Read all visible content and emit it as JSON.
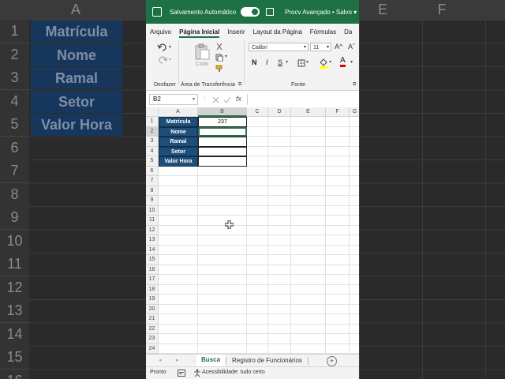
{
  "background": {
    "columns": [
      "A",
      "E",
      "F"
    ],
    "rows": [
      "1",
      "2",
      "3",
      "4",
      "5",
      "6",
      "7",
      "8",
      "9",
      "10",
      "11",
      "12",
      "13",
      "14",
      "15",
      "16"
    ],
    "labels": [
      "Matrícula",
      "Nome",
      "Ramal",
      "Setor",
      "Valor Hora"
    ]
  },
  "titlebar": {
    "autosave_label": "Salvamento Automático",
    "doc_name": "Procv Avançado • Salvo",
    "doc_caret": "▾"
  },
  "tabs": [
    "Arquivo",
    "Página Inicial",
    "Inserir",
    "Layout da Página",
    "Fórmulas",
    "Da"
  ],
  "ribbon": {
    "undo_group": "Desfazer",
    "clipboard_group": "Área de Transferência",
    "paste_label": "Colar",
    "font_group": "Fonte",
    "font_name": "Calibri",
    "font_size": "11",
    "bold": "N",
    "italic": "I",
    "underline": "S",
    "grow_font": "A^",
    "shrink_font": "Aˇ",
    "font_color_letter": "A"
  },
  "formula_bar": {
    "name_box": "B2",
    "fx": "fx",
    "content": ""
  },
  "sheet": {
    "columns": [
      "A",
      "B",
      "C",
      "D",
      "E",
      "F",
      "G"
    ],
    "selected_column": "B",
    "row_numbers": [
      "1",
      "2",
      "3",
      "4",
      "5",
      "6",
      "7",
      "8",
      "9",
      "10",
      "11",
      "12",
      "13",
      "14",
      "15",
      "16",
      "17",
      "18",
      "19",
      "20",
      "21",
      "22",
      "23",
      "24"
    ],
    "selected_row": "2",
    "labels": [
      "Matrícula",
      "Nome",
      "Ramal",
      "Setor",
      "Valor Hora"
    ],
    "values": [
      "237",
      "",
      "",
      "",
      ""
    ],
    "active_cell": "B2"
  },
  "sheet_tabs": {
    "tabs": [
      "Busca",
      "Registro de Funcionários"
    ],
    "active": "Busca",
    "add_label": "+"
  },
  "status_bar": {
    "ready": "Pronto",
    "accessibility": "Acessibilidade: tudo certo"
  },
  "colors": {
    "excel_green": "#1e7145",
    "label_fill": "#1f4e79",
    "active_border": "#217346"
  }
}
